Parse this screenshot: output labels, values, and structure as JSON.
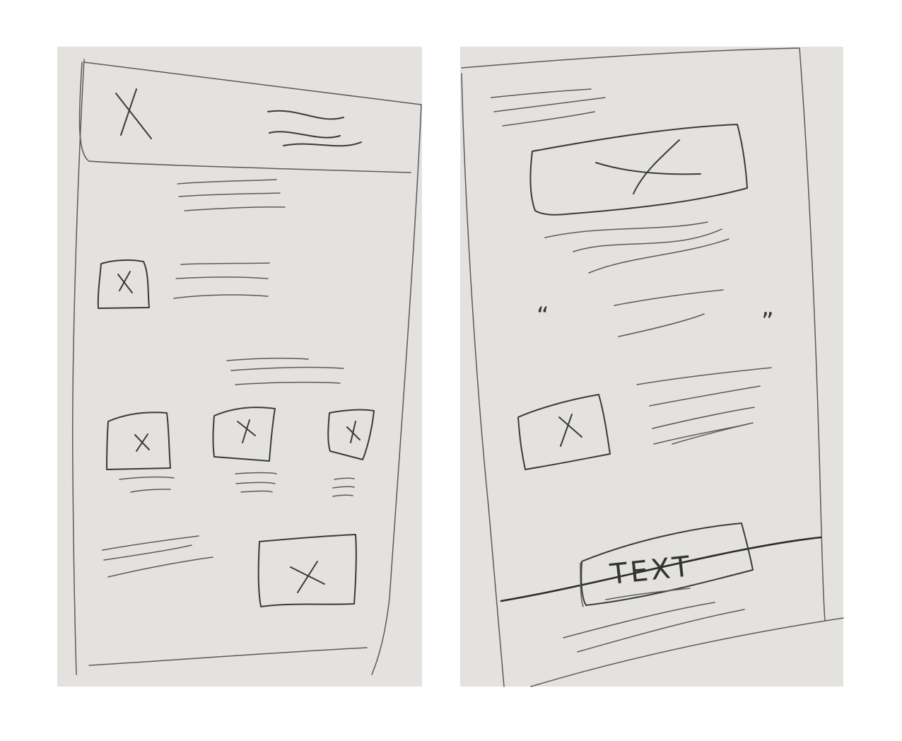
{
  "wireframes": {
    "left": {
      "screen": "phone-wireframe-left"
    },
    "right": {
      "screen": "phone-wireframe-right",
      "quote_open": "“",
      "quote_close": "”",
      "button_label": "TEXT"
    }
  },
  "colors": {
    "paper": "#e3e2df",
    "pencil": "#3a3a3a",
    "background": "#ffffff"
  }
}
